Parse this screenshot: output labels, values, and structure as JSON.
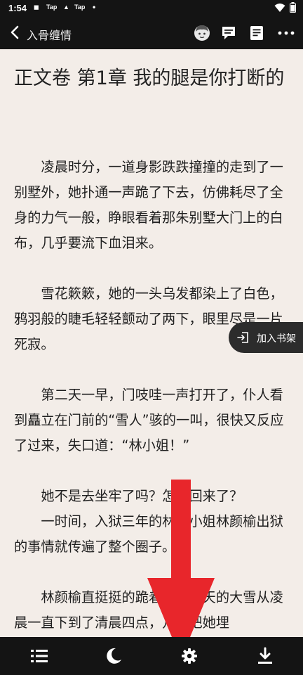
{
  "status_bar": {
    "time": "1:54",
    "icon1": "Tap",
    "icon2": "Tap",
    "dot": "•"
  },
  "header": {
    "book_title": "入骨缠情"
  },
  "chapter": {
    "title": "正文卷 第1章 我的腿是你打断的"
  },
  "paragraphs": [
    "凌晨时分，一道身影跌跌撞撞的走到了一别墅外，她扑通一声跪了下去，仿佛耗尽了全身的力气一般，睁眼看着那朱别墅大门上的白布，几乎要流下血泪来。",
    "雪花簌簌，她的一头乌发都染上了白色，鸦羽般的睫毛轻轻颤动了两下，眼里尽是一片死寂。",
    "第二天一早，门吱哇一声打开了，仆人看到矗立在门前的“雪人”骇的一叫，很快又反应了过来，失口道：“林小姐！”",
    "她不是去坐牢了吗？怎么回来了？",
    "一时间，入狱三年的林家小姐林颜榆出狱的事情就传遍了整个圈子。",
    "林颜榆直挺挺的跪着，那漫天的大雪从凌晨一直下到了清晨四点，几乎把她埋"
  ],
  "shelf_button": {
    "label": "加入书架"
  },
  "icons": {
    "back": "chevron-left-icon",
    "avatar": "avatar-icon",
    "comment": "comment-icon",
    "catalog": "document-icon",
    "more": "more-icon",
    "menu": "list-icon",
    "night": "moon-icon",
    "settings": "gear-icon",
    "download": "download-icon"
  },
  "colors": {
    "bar": "#141414",
    "page": "#f3ede8",
    "text": "#1f1f1f",
    "arrow": "#e8262b"
  }
}
